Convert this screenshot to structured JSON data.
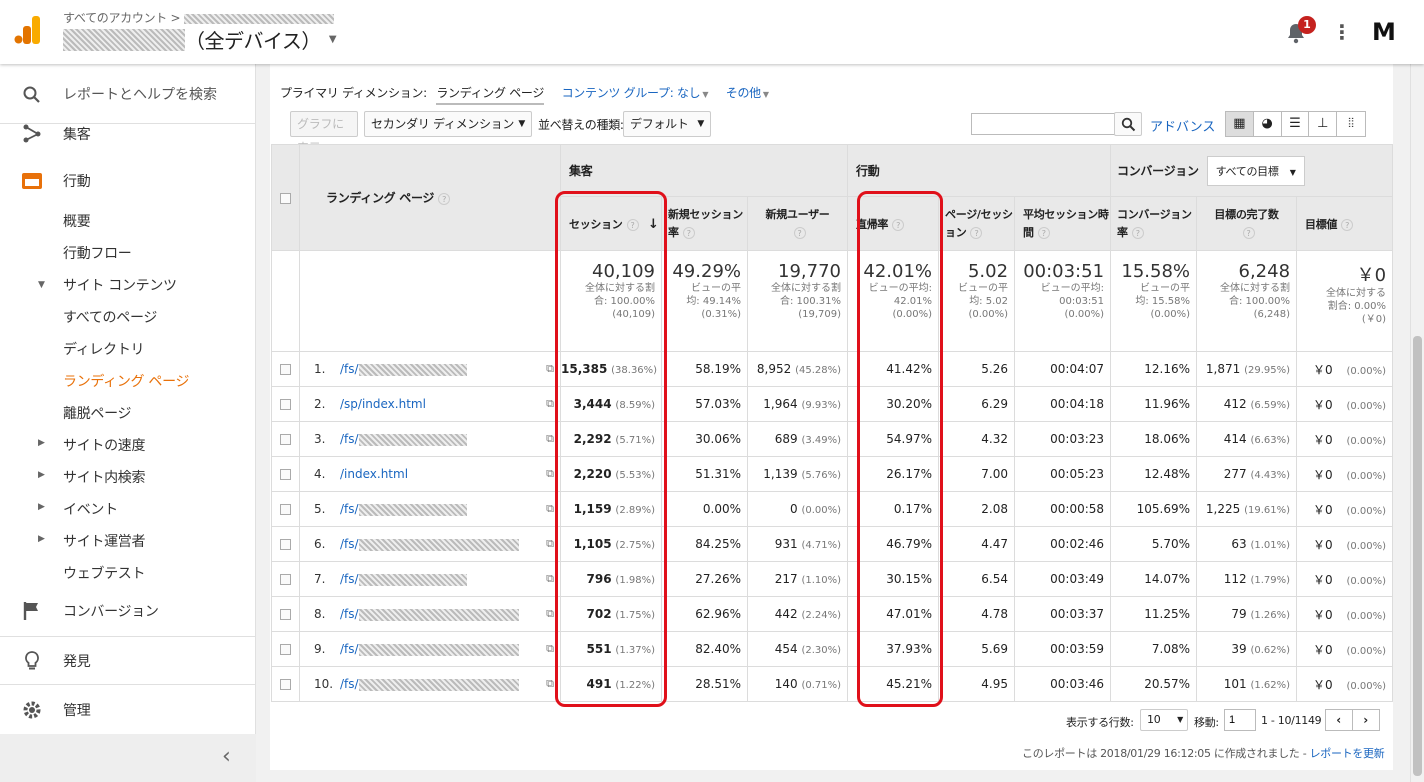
{
  "header": {
    "account_breadcrumb": "すべてのアカウント >",
    "view_suffix": "（全デバイス）",
    "notification_count": "1",
    "avatar_letter": "M"
  },
  "sidebar": {
    "search_label": "レポートとヘルプを検索",
    "acquisition": "集客",
    "behavior": "行動",
    "behavior_items": [
      "概要",
      "行動フロー"
    ],
    "site_content": "サイト コンテンツ",
    "site_content_items": [
      "すべてのページ",
      "ディレクトリ",
      "ランディング ページ",
      "離脱ページ"
    ],
    "collapsed_items": [
      "サイトの速度",
      "サイト内検索",
      "イベント",
      "サイト運営者"
    ],
    "web_test": "ウェブテスト",
    "conversion": "コンバージョン",
    "discover": "発見",
    "admin": "管理",
    "collapse_icon": "‹"
  },
  "toolbar": {
    "primary_dimension_label": "プライマリ ディメンション:",
    "primary_dimension_value": "ランディング ページ",
    "content_group": "コンテンツ グループ: なし",
    "other": "その他",
    "graph_button": "グラフに表示",
    "secondary_dimension": "セカンダリ ディメンション",
    "sort_label": "並べ替えの種類:",
    "sort_value": "デフォルト",
    "search_placeholder": "",
    "advanced": "アドバンス"
  },
  "table": {
    "group_headers": {
      "acquisition": "集客",
      "behavior": "行動",
      "conversion": "コンバージョン",
      "goal_select": "すべての目標"
    },
    "col_landing_page": "ランディング ページ",
    "columns": [
      "セッション",
      "新規セッション率",
      "新規ユーザー",
      "直帰率",
      "ページ/セッション",
      "平均セッション時間",
      "コンバージョン率",
      "目標の完了数",
      "目標値"
    ],
    "totals": [
      {
        "big": "40,109",
        "l1": "全体に対する割",
        "l2": "合: 100.00%",
        "l3": "(40,109)"
      },
      {
        "big": "49.29%",
        "l1": "ビューの平",
        "l2": "均: 49.14%",
        "l3": "(0.31%)"
      },
      {
        "big": "19,770",
        "l1": "全体に対する割",
        "l2": "合: 100.31%",
        "l3": "(19,709)"
      },
      {
        "big": "42.01%",
        "l1": "ビューの平均:",
        "l2": "42.01%",
        "l3": "(0.00%)"
      },
      {
        "big": "5.02",
        "l1": "ビューの平",
        "l2": "均: 5.02",
        "l3": "(0.00%)"
      },
      {
        "big": "00:03:51",
        "l1": "ビューの平均:",
        "l2": "00:03:51",
        "l3": "(0.00%)"
      },
      {
        "big": "15.58%",
        "l1": "ビューの平",
        "l2": "均: 15.58%",
        "l3": "(0.00%)"
      },
      {
        "big": "6,248",
        "l1": "全体に対する割",
        "l2": "合: 100.00%",
        "l3": "(6,248)"
      },
      {
        "big": "￥0",
        "l1": "全体に対する",
        "l2": "割合: 0.00%",
        "l3": "(￥0)"
      }
    ],
    "rows": [
      {
        "n": "1.",
        "page": "/fs/",
        "s": "15,385",
        "sp": "(38.36%)",
        "nsr": "58.19%",
        "nu": "8,952",
        "nup": "(45.28%)",
        "br": "41.42%",
        "pps": "5.26",
        "ast": "00:04:07",
        "cr": "12.16%",
        "gc": "1,871",
        "gcp": "(29.95%)",
        "gv": "￥0",
        "gvp": "(0.00%)"
      },
      {
        "n": "2.",
        "page": "/sp/index.html",
        "s": "3,444",
        "sp": "(8.59%)",
        "nsr": "57.03%",
        "nu": "1,964",
        "nup": "(9.93%)",
        "br": "30.20%",
        "pps": "6.29",
        "ast": "00:04:18",
        "cr": "11.96%",
        "gc": "412",
        "gcp": "(6.59%)",
        "gv": "￥0",
        "gvp": "(0.00%)"
      },
      {
        "n": "3.",
        "page": "/fs/",
        "s": "2,292",
        "sp": "(5.71%)",
        "nsr": "30.06%",
        "nu": "689",
        "nup": "(3.49%)",
        "br": "54.97%",
        "pps": "4.32",
        "ast": "00:03:23",
        "cr": "18.06%",
        "gc": "414",
        "gcp": "(6.63%)",
        "gv": "￥0",
        "gvp": "(0.00%)"
      },
      {
        "n": "4.",
        "page": "/index.html",
        "s": "2,220",
        "sp": "(5.53%)",
        "nsr": "51.31%",
        "nu": "1,139",
        "nup": "(5.76%)",
        "br": "26.17%",
        "pps": "7.00",
        "ast": "00:05:23",
        "cr": "12.48%",
        "gc": "277",
        "gcp": "(4.43%)",
        "gv": "￥0",
        "gvp": "(0.00%)"
      },
      {
        "n": "5.",
        "page": "/fs/",
        "s": "1,159",
        "sp": "(2.89%)",
        "nsr": "0.00%",
        "nu": "0",
        "nup": "(0.00%)",
        "br": "0.17%",
        "pps": "2.08",
        "ast": "00:00:58",
        "cr": "105.69%",
        "gc": "1,225",
        "gcp": "(19.61%)",
        "gv": "￥0",
        "gvp": "(0.00%)"
      },
      {
        "n": "6.",
        "page": "/fs/",
        "s": "1,105",
        "sp": "(2.75%)",
        "nsr": "84.25%",
        "nu": "931",
        "nup": "(4.71%)",
        "br": "46.79%",
        "pps": "4.47",
        "ast": "00:02:46",
        "cr": "5.70%",
        "gc": "63",
        "gcp": "(1.01%)",
        "gv": "￥0",
        "gvp": "(0.00%)"
      },
      {
        "n": "7.",
        "page": "/fs/",
        "s": "796",
        "sp": "(1.98%)",
        "nsr": "27.26%",
        "nu": "217",
        "nup": "(1.10%)",
        "br": "30.15%",
        "pps": "6.54",
        "ast": "00:03:49",
        "cr": "14.07%",
        "gc": "112",
        "gcp": "(1.79%)",
        "gv": "￥0",
        "gvp": "(0.00%)"
      },
      {
        "n": "8.",
        "page": "/fs/",
        "s": "702",
        "sp": "(1.75%)",
        "nsr": "62.96%",
        "nu": "442",
        "nup": "(2.24%)",
        "br": "47.01%",
        "pps": "4.78",
        "ast": "00:03:37",
        "cr": "11.25%",
        "gc": "79",
        "gcp": "(1.26%)",
        "gv": "￥0",
        "gvp": "(0.00%)"
      },
      {
        "n": "9.",
        "page": "/fs/",
        "s": "551",
        "sp": "(1.37%)",
        "nsr": "82.40%",
        "nu": "454",
        "nup": "(2.30%)",
        "br": "37.93%",
        "pps": "5.69",
        "ast": "00:03:59",
        "cr": "7.08%",
        "gc": "39",
        "gcp": "(0.62%)",
        "gv": "￥0",
        "gvp": "(0.00%)"
      },
      {
        "n": "10.",
        "page": "/fs/",
        "s": "491",
        "sp": "(1.22%)",
        "nsr": "28.51%",
        "nu": "140",
        "nup": "(0.71%)",
        "br": "45.21%",
        "pps": "4.95",
        "ast": "00:03:46",
        "cr": "20.57%",
        "gc": "101",
        "gcp": "(1.62%)",
        "gv": "￥0",
        "gvp": "(0.00%)"
      }
    ]
  },
  "pagination": {
    "rows_label": "表示する行数:",
    "rows_value": "10",
    "goto_label": "移動:",
    "goto_value": "1",
    "range": "1 - 10/1149"
  },
  "footer": {
    "created": "このレポートは 2018/01/29 16:12:05 に作成されました -",
    "refresh": "レポートを更新"
  },
  "colors": {
    "accent": "#e8710a",
    "link": "#1a66c0",
    "highlight": "#e0101a"
  }
}
